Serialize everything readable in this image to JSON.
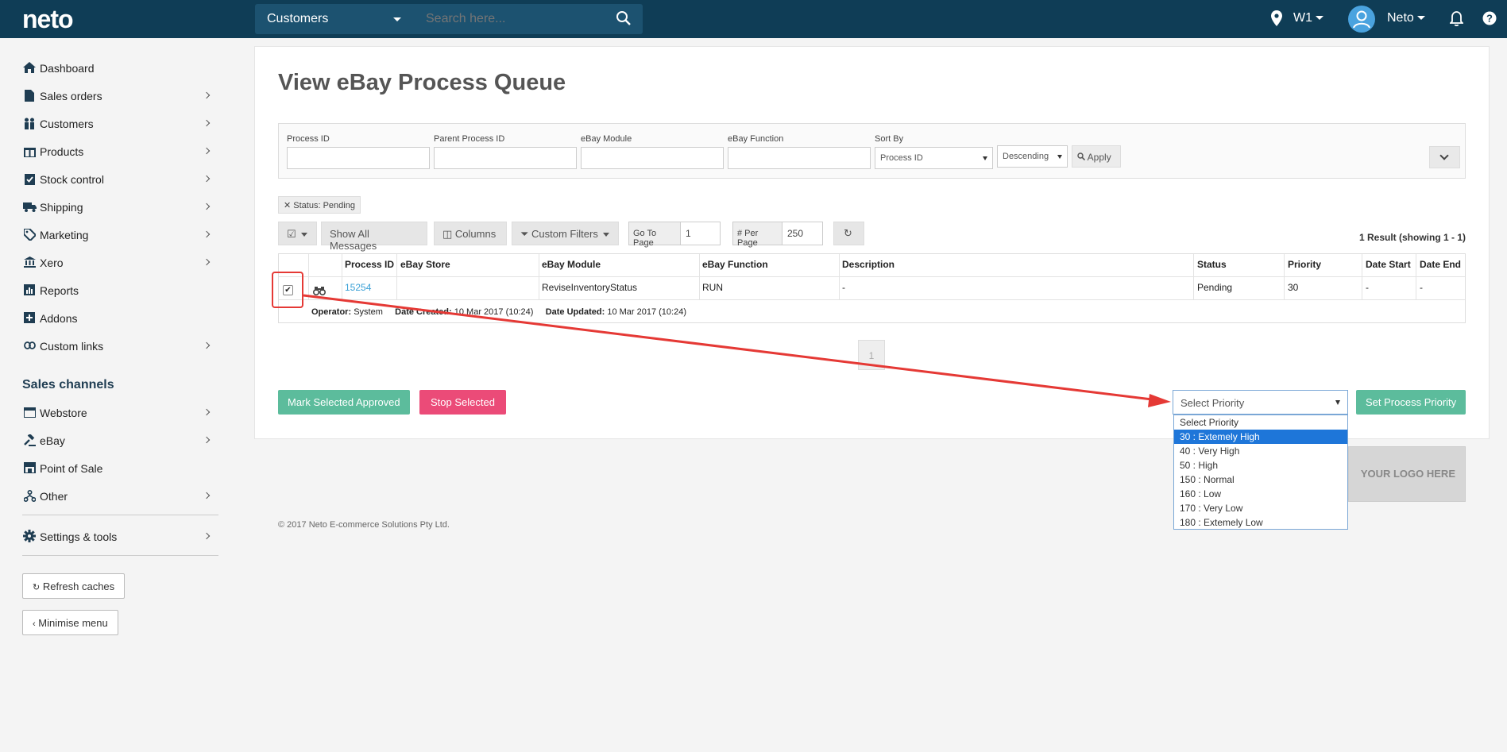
{
  "topbar": {
    "logo": "neto",
    "search_scope": "Customers",
    "search_placeholder": "Search here...",
    "location": "W1",
    "user": "Neto"
  },
  "sidebar": {
    "items": [
      {
        "label": "Dashboard",
        "icon": "home-icon"
      },
      {
        "label": "Sales orders",
        "icon": "document-icon"
      },
      {
        "label": "Customers",
        "icon": "users-icon"
      },
      {
        "label": "Products",
        "icon": "gift-icon"
      },
      {
        "label": "Stock control",
        "icon": "clipboard-check-icon"
      },
      {
        "label": "Shipping",
        "icon": "truck-icon"
      },
      {
        "label": "Marketing",
        "icon": "tag-icon"
      },
      {
        "label": "Xero",
        "icon": "bank-icon"
      },
      {
        "label": "Reports",
        "icon": "bar-chart-icon"
      },
      {
        "label": "Addons",
        "icon": "plus-square-icon"
      },
      {
        "label": "Custom links",
        "icon": "link-icon"
      }
    ],
    "channels_title": "Sales channels",
    "channels": [
      {
        "label": "Webstore",
        "icon": "webstore-icon"
      },
      {
        "label": "eBay",
        "icon": "gavel-icon"
      },
      {
        "label": "Point of Sale",
        "icon": "store-icon"
      },
      {
        "label": "Other",
        "icon": "sitemap-icon"
      }
    ],
    "settings": "Settings & tools",
    "refresh_caches": "Refresh caches",
    "minimise_menu": "Minimise menu"
  },
  "page": {
    "title": "View eBay Process Queue",
    "filters": {
      "process_id_label": "Process ID",
      "parent_process_id_label": "Parent Process ID",
      "ebay_module_label": "eBay Module",
      "ebay_function_label": "eBay Function",
      "sort_by_label": "Sort By",
      "sort_by_value": "Process ID",
      "order_value": "Descending",
      "apply": "Apply"
    },
    "active_filter": "Status: Pending",
    "toolbar": {
      "show_all_messages": "Show All Messages",
      "columns": "Columns",
      "custom_filters": "Custom Filters",
      "go_to_page_label": "Go To Page",
      "go_to_page_value": "1",
      "per_page_label": "# Per Page",
      "per_page_value": "250",
      "results": "1 Result (showing 1 - 1)"
    },
    "table": {
      "headers": [
        "Process ID",
        "eBay Store",
        "eBay Module",
        "eBay Function",
        "Description",
        "Status",
        "Priority",
        "Date Start",
        "Date End"
      ],
      "row": {
        "process_id": "15254",
        "ebay_store": "",
        "ebay_module": "ReviseInventoryStatus",
        "ebay_function": "RUN",
        "description": "-",
        "status": "Pending",
        "priority": "30",
        "date_start": "-",
        "date_end": "-"
      },
      "meta": {
        "operator_label": "Operator:",
        "operator": "System",
        "date_created_label": "Date Created:",
        "date_created": "10 Mar 2017 (10:24)",
        "date_updated_label": "Date Updated:",
        "date_updated": "10 Mar 2017 (10:24)"
      }
    },
    "pager_page": "1",
    "mark_approved": "Mark Selected Approved",
    "stop_selected": "Stop Selected",
    "priority_select": "Select Priority",
    "priority_options": [
      "Select Priority",
      "30 : Extemely High",
      "40 : Very High",
      "50 : High",
      "150 : Normal",
      "160 : Low",
      "170 : Very Low",
      "180 : Extemely Low"
    ],
    "priority_selected_index": 1,
    "set_priority": "Set Process Priority",
    "logo_placeholder": "YOUR LOGO HERE",
    "copyright": "© 2017 Neto E-commerce Solutions Pty Ltd."
  },
  "colors": {
    "topbar": "#0f3d56",
    "green": "#5cbc9c",
    "pink": "#eb4b78",
    "link": "#3aa0d6",
    "annotation": "#e53935"
  }
}
